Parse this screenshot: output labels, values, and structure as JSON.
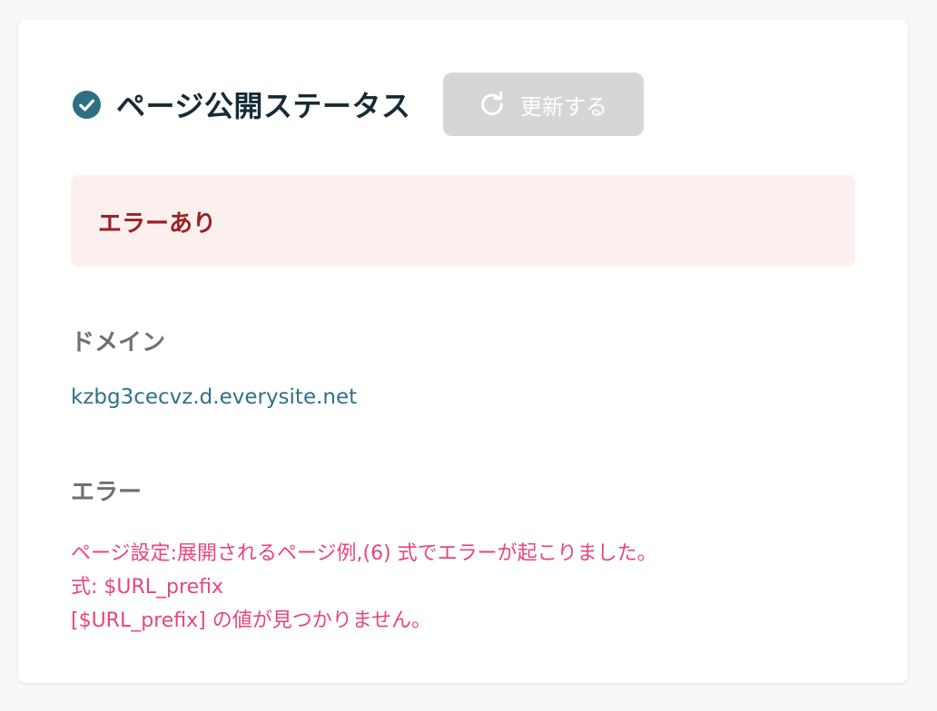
{
  "header": {
    "title": "ページ公開ステータス",
    "status_icon": "check-circle-icon",
    "refresh_icon": "refresh-icon",
    "refresh_label": "更新する"
  },
  "alert": {
    "text": "エラーあり"
  },
  "domain": {
    "label": "ドメイン",
    "value": "kzbg3cecvz.d.everysite.net"
  },
  "error": {
    "label": "エラー",
    "lines": [
      "ページ設定:展開されるページ例,(6) 式でエラーが起こりました。",
      "式: $URL_prefix",
      "[$URL_prefix] の値が見つかりません。"
    ]
  },
  "colors": {
    "title": "#172b36",
    "check_icon": "#2e6f83",
    "button_bg": "#d6d6d6",
    "alert_bg": "#fcf0ef",
    "alert_text": "#9b2125",
    "section_label": "#707070",
    "domain_link": "#2e7188",
    "error_text": "#e8457a"
  }
}
